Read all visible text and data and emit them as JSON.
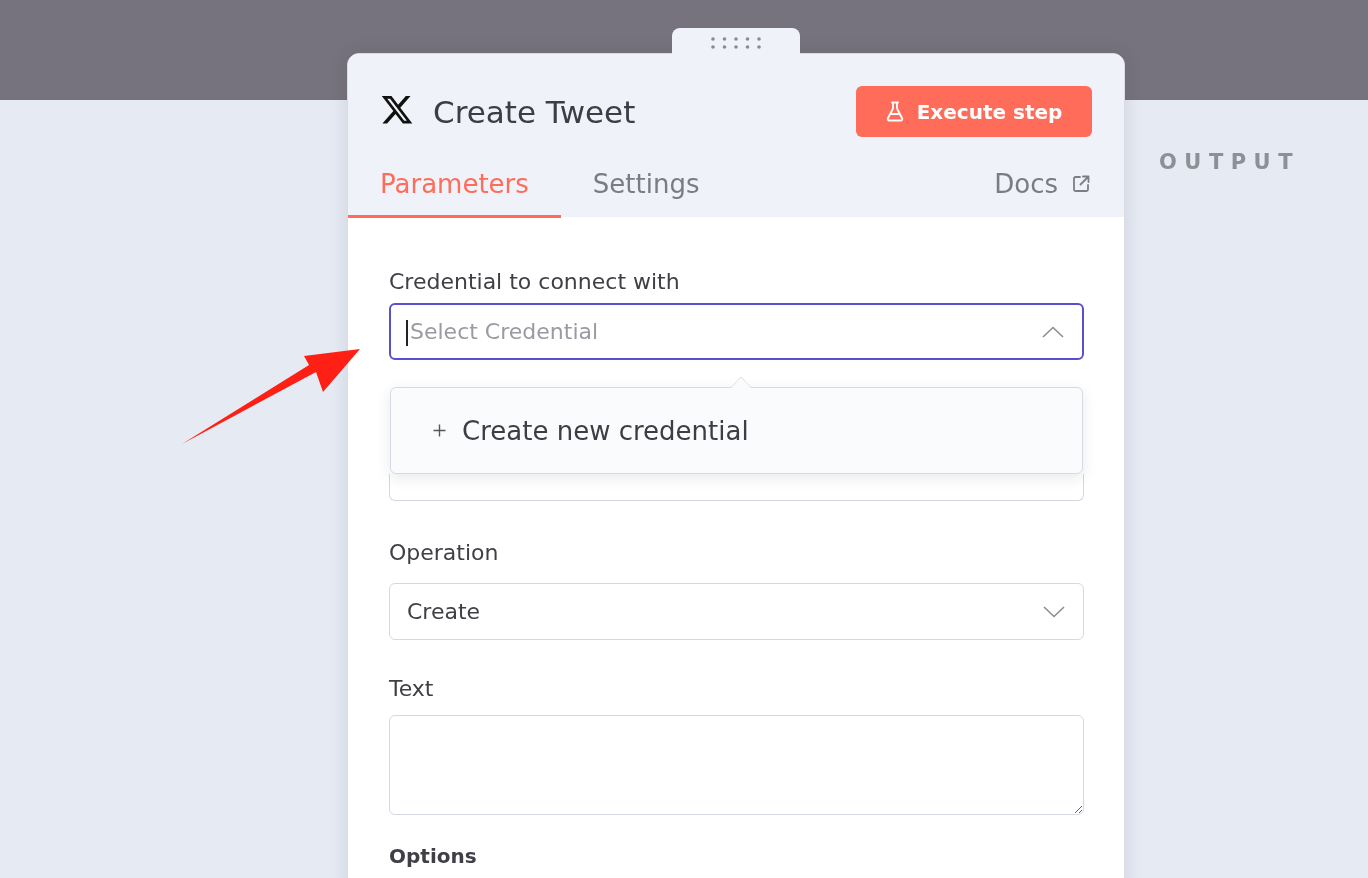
{
  "canvas": {
    "output_label": "OUTPUT"
  },
  "panel": {
    "title": "Create Tweet",
    "execute_button": {
      "label": "Execute step"
    },
    "tabs": [
      {
        "label": "Parameters",
        "selected": true
      },
      {
        "label": "Settings",
        "selected": false
      }
    ],
    "docs_link": {
      "label": "Docs"
    },
    "fields": [
      {
        "kind": "select",
        "label": "Credential to connect with",
        "placeholder": "Select Credential",
        "open": true,
        "menu_items": [
          {
            "label": "Create new credential"
          }
        ]
      },
      {
        "kind": "covered"
      },
      {
        "kind": "select",
        "label": "Operation",
        "value": "Create",
        "open": false
      },
      {
        "kind": "textarea",
        "label": "Text"
      },
      {
        "kind": "heading",
        "label": "Options"
      }
    ]
  },
  "annotation": {
    "kind": "arrow"
  }
}
